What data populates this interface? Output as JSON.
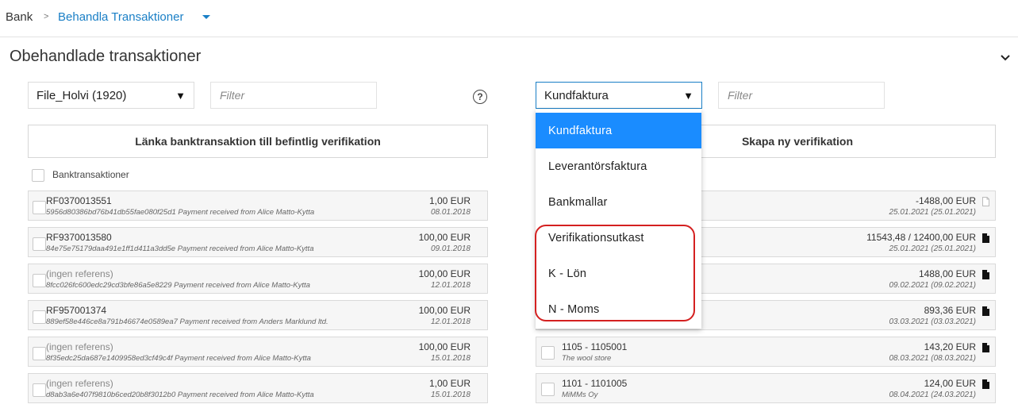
{
  "breadcrumb": {
    "root": "Bank",
    "separator": ">",
    "current": "Behandla Transaktioner"
  },
  "section": {
    "title": "Obehandlade transaktioner"
  },
  "left": {
    "account_select": "File_Holvi (1920)",
    "filter_placeholder": "Filter",
    "link_button": "Länka banktransaktion till befintlig verifikation",
    "header_label": "Banktransaktioner",
    "rows": [
      {
        "ref": "RF0370013551",
        "desc": "5956d80386bd76b41db55fae080f25d1 Payment received from Alice Matto-Kytta",
        "amount": "1,00 EUR",
        "date": "08.01.2018"
      },
      {
        "ref": "RF9370013580",
        "desc": "84e75e75179daa491e1ff1d411a3dd5e Payment received from Alice Matto-Kytta",
        "amount": "100,00 EUR",
        "date": "09.01.2018"
      },
      {
        "ref": "(ingen referens)",
        "desc": "8fcc026fc600edc29cd3bfe86a5e8229 Payment received from Alice Matto-Kytta",
        "amount": "100,00 EUR",
        "date": "12.01.2018"
      },
      {
        "ref": "RF957001374",
        "desc": "889ef58e446ce8a791b46674e0589ea7 Payment received from Anders Marklund ltd.",
        "amount": "100,00 EUR",
        "date": "12.01.2018"
      },
      {
        "ref": "(ingen referens)",
        "desc": "8f35edc25da687e1409958ed3cf49c4f Payment received from Alice Matto-Kytta",
        "amount": "100,00 EUR",
        "date": "15.01.2018"
      },
      {
        "ref": "(ingen referens)",
        "desc": "d8ab3a6e407f9810b6ced20b8f3012b0 Payment received from Alice Matto-Kytta",
        "amount": "1,00 EUR",
        "date": "15.01.2018"
      }
    ]
  },
  "right": {
    "type_select": "Kundfaktura",
    "filter_placeholder": "Filter",
    "create_button": "Skapa ny verifikation",
    "rows": [
      {
        "ref": "",
        "desc": "",
        "amount": "-1488,00 EUR",
        "date": "25.01.2021 (25.01.2021)",
        "doc_icon": "file-outline-icon"
      },
      {
        "ref": "",
        "desc": "",
        "amount": "11543,48 / 12400,00 EUR",
        "date": "25.01.2021 (25.01.2021)",
        "doc_icon": "file-icon"
      },
      {
        "ref": "",
        "desc": "",
        "amount": "1488,00 EUR",
        "date": "09.02.2021 (09.02.2021)",
        "doc_icon": "file-icon"
      },
      {
        "ref": "",
        "desc": "",
        "amount": "893,36 EUR",
        "date": "03.03.2021 (03.03.2021)",
        "doc_icon": "file-icon"
      },
      {
        "ref": "1105 - 1105001",
        "desc": "The wool store",
        "amount": "143,20 EUR",
        "date": "08.03.2021 (08.03.2021)",
        "doc_icon": "file-icon"
      },
      {
        "ref": "1101 - 1101005",
        "desc": "MiMMs Oy",
        "amount": "124,00 EUR",
        "date": "08.04.2021 (24.03.2021)",
        "doc_icon": "file-icon"
      }
    ]
  },
  "dropdown": {
    "options": [
      "Kundfaktura",
      "Leverantörsfaktura",
      "Bankmallar",
      "Verifikationsutkast",
      "K - Lön",
      "N - Moms"
    ],
    "selected": "Kundfaktura"
  },
  "colors": {
    "accent": "#1a7fc6",
    "selected_option": "#1a8cff",
    "highlight_border": "#d42020"
  }
}
